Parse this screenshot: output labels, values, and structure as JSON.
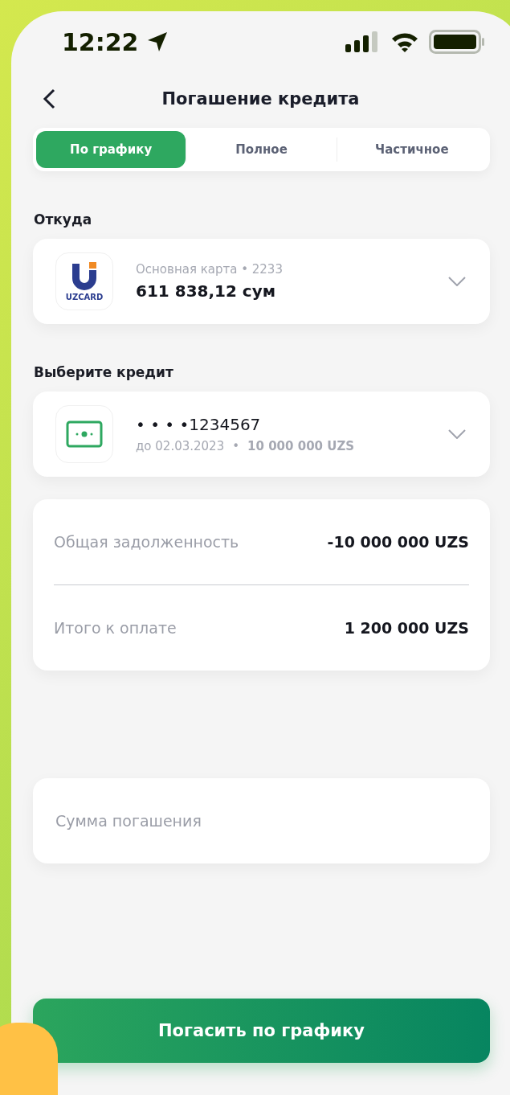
{
  "status_bar": {
    "time": "12:22"
  },
  "header": {
    "title": "Погашение кредита"
  },
  "tabs": [
    {
      "label": "По графику",
      "selected": true
    },
    {
      "label": "Полное",
      "selected": false
    },
    {
      "label": "Частичное",
      "selected": false
    }
  ],
  "source": {
    "label": "Откуда",
    "card": {
      "logo_text": "UZCARD",
      "name": "Основная карта • 2233",
      "balance": "611 838,12 сум"
    }
  },
  "credit": {
    "label": "Выберите кредит",
    "card": {
      "number": "• • • •1234567",
      "due": "до 02.03.2023",
      "separator": "•",
      "amount": "10 000 000 UZS"
    }
  },
  "summary": [
    {
      "label": "Общая задолженность",
      "value": "-10 000 000 UZS"
    },
    {
      "label": "Итого к оплате",
      "value": "1 200 000 UZS"
    }
  ],
  "amount_field": {
    "placeholder": "Сумма погашения"
  },
  "submit_button": {
    "label": "Погасить по графику"
  }
}
